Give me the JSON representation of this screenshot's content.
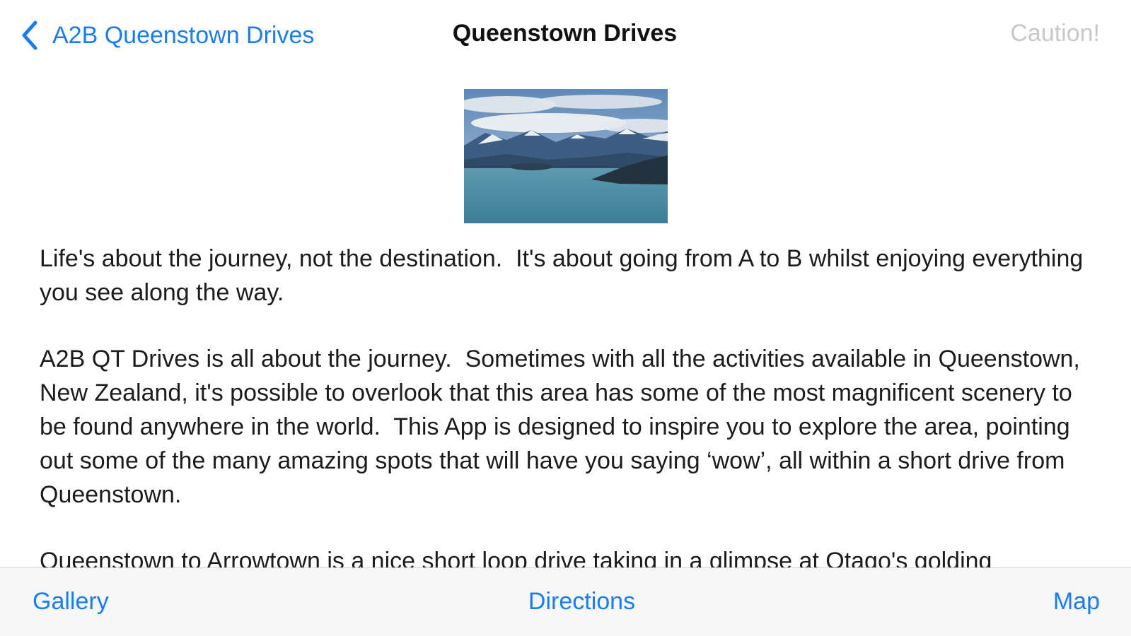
{
  "navbar": {
    "back_label": "A2B Queenstown Drives",
    "title": "Queenstown Drives",
    "caution_label": "Caution!"
  },
  "content": {
    "paragraphs": [
      "Life's about the journey, not the destination.  It's about going from A to B whilst enjoying everything you see along the way.",
      "A2B QT Drives is all about the journey.  Sometimes with all the activities available in Queenstown, New Zealand, it's possible to overlook that this area has some of the most magnificent scenery to be found anywhere in the world.  This App is designed to inspire you to explore the area, pointing out some of the many amazing spots that will have you saying ‘wow’, all within a short drive from Queenstown.",
      "Queenstown to Arrowtown is a nice short loop drive taking in a glimpse at Otago's golding"
    ]
  },
  "toolbar": {
    "gallery_label": "Gallery",
    "directions_label": "Directions",
    "map_label": "Map"
  },
  "colors": {
    "accent": "#1a7cf2",
    "disabled": "#c8c8cc",
    "toolbar_bg": "#f7f7f7",
    "text": "#1c1c1e"
  },
  "icons": {
    "back": "chevron-left-icon"
  }
}
